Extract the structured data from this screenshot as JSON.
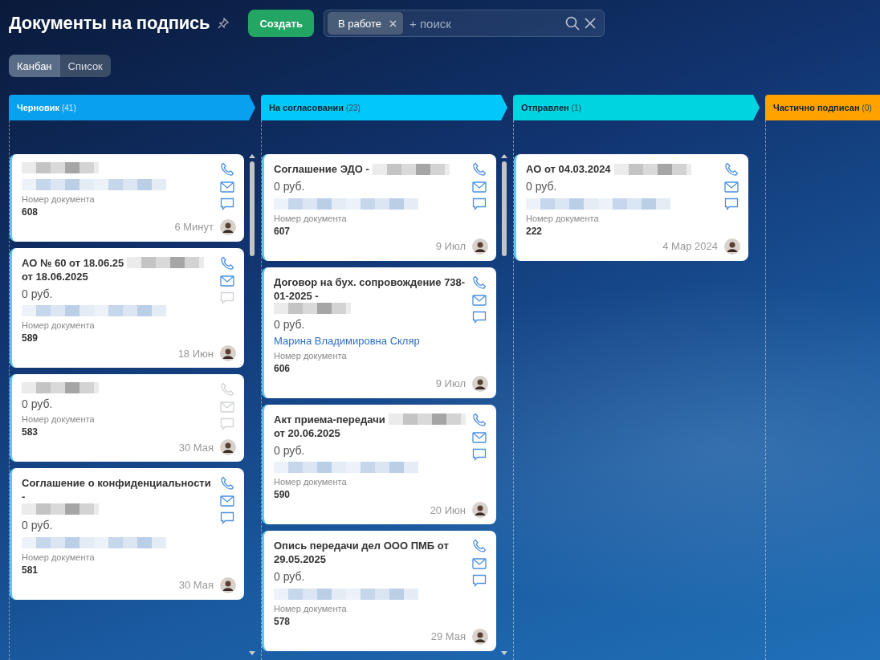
{
  "page": {
    "title": "Документы на подпись",
    "create_button": "Создать"
  },
  "search": {
    "chip": "В работе",
    "placeholder": "+ поиск"
  },
  "views": [
    {
      "label": "Канбан",
      "selected": true
    },
    {
      "label": "Список",
      "selected": false
    }
  ],
  "columns": [
    {
      "name": "Черновик",
      "count": "(41)",
      "color": "#0aa0f0",
      "scrollable": true,
      "cards": [
        {
          "title": [
            {
              "kind": "redacted"
            }
          ],
          "contact": [
            {
              "kind": "redacted"
            }
          ],
          "doc_label": "Номер документа",
          "doc_number": "608",
          "date": "6 Минут",
          "phone_disabled": false,
          "mail_disabled": false,
          "chat_disabled": false
        },
        {
          "title": [
            {
              "kind": "text",
              "text": "АО № 60 от 18.06.25"
            },
            {
              "kind": "redacted"
            },
            {
              "kind": "text",
              "text": "от 18.06.2025"
            }
          ],
          "amount": "0 руб.",
          "contact": [
            {
              "kind": "redacted"
            }
          ],
          "doc_label": "Номер документа",
          "doc_number": "589",
          "date": "18 Июн",
          "phone_disabled": false,
          "mail_disabled": false,
          "chat_disabled": true
        },
        {
          "title": [
            {
              "kind": "redacted"
            }
          ],
          "amount": "0 руб.",
          "doc_label": "Номер документа",
          "doc_number": "583",
          "date": "30 Мая",
          "phone_disabled": true,
          "mail_disabled": true,
          "chat_disabled": true
        },
        {
          "title": [
            {
              "kind": "text",
              "text": "Соглашение о конфиденциальности -"
            },
            {
              "kind": "redacted"
            }
          ],
          "amount": "0 руб.",
          "contact": [
            {
              "kind": "redacted"
            }
          ],
          "doc_label": "Номер документа",
          "doc_number": "581",
          "date": "30 Мая",
          "phone_disabled": false,
          "mail_disabled": false,
          "chat_disabled": false
        }
      ]
    },
    {
      "name": "На согласовании",
      "count": "(23)",
      "color": "#00c8f8",
      "scrollable": true,
      "cards": [
        {
          "title": [
            {
              "kind": "text",
              "text": "Соглашение ЭДО -"
            },
            {
              "kind": "redacted"
            }
          ],
          "amount": "0 руб.",
          "contact": [
            {
              "kind": "redacted"
            }
          ],
          "doc_label": "Номер документа",
          "doc_number": "607",
          "date": "9 Июл",
          "phone_disabled": false,
          "mail_disabled": false,
          "chat_disabled": false
        },
        {
          "title": [
            {
              "kind": "text",
              "text": "Договор на бух. сопровождение 738-01-2025 -"
            },
            {
              "kind": "redacted"
            }
          ],
          "amount": "0 руб.",
          "contact": [
            {
              "kind": "text",
              "text": "Марина Владимировна Скляр"
            }
          ],
          "doc_label": "Номер документа",
          "doc_number": "606",
          "date": "9 Июл",
          "phone_disabled": false,
          "mail_disabled": false,
          "chat_disabled": false
        },
        {
          "title": [
            {
              "kind": "text",
              "text": "Акт приема-передачи"
            },
            {
              "kind": "redacted"
            },
            {
              "kind": "text",
              "text": "от 20.06.2025"
            }
          ],
          "amount": "0 руб.",
          "contact": [
            {
              "kind": "redacted"
            }
          ],
          "doc_label": "Номер документа",
          "doc_number": "590",
          "date": "20 Июн",
          "phone_disabled": false,
          "mail_disabled": false,
          "chat_disabled": false
        },
        {
          "title": [
            {
              "kind": "text",
              "text": "Опись передачи дел ООО ПМБ от 29.05.2025"
            }
          ],
          "amount": "0 руб.",
          "contact": [
            {
              "kind": "redacted"
            }
          ],
          "doc_label": "Номер документа",
          "doc_number": "578",
          "date": "29 Мая",
          "phone_disabled": false,
          "mail_disabled": false,
          "chat_disabled": false
        }
      ]
    },
    {
      "name": "Отправлен",
      "count": "(1)",
      "color": "#00d4e0",
      "scrollable": false,
      "cards": [
        {
          "title": [
            {
              "kind": "text",
              "text": "АО от 04.03.2024"
            },
            {
              "kind": "redacted"
            }
          ],
          "amount": "0 руб.",
          "contact": [
            {
              "kind": "redacted"
            }
          ],
          "doc_label": "Номер документа",
          "doc_number": "222",
          "date": "4 Мар 2024",
          "phone_disabled": false,
          "mail_disabled": false,
          "chat_disabled": false
        }
      ]
    },
    {
      "name": "Частично подписан",
      "count": "(0)",
      "color": "#ffa200",
      "scrollable": false
    }
  ]
}
